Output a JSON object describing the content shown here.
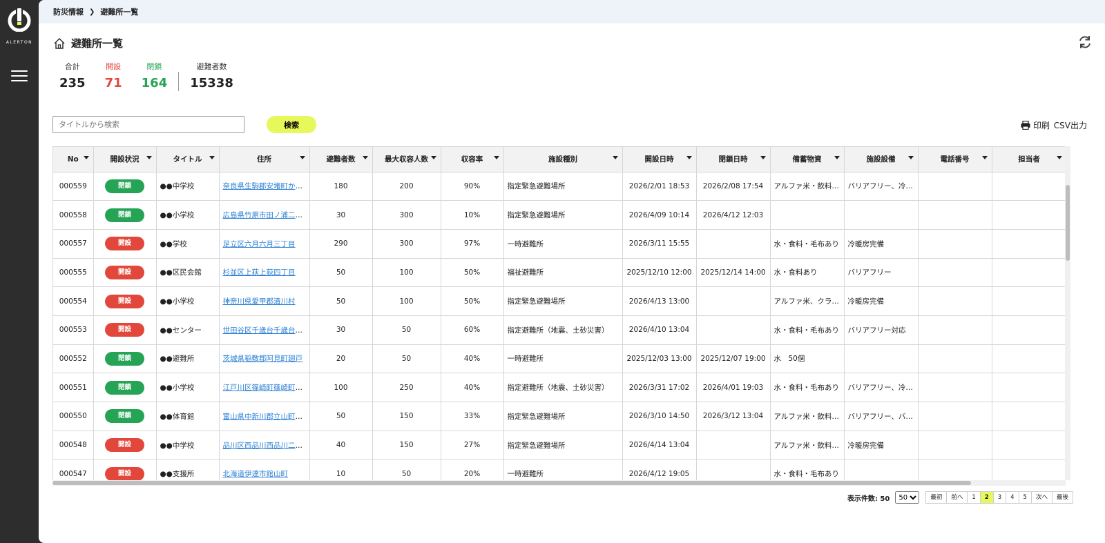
{
  "app": {
    "logo_text": "ALERTON"
  },
  "breadcrumb": {
    "parent": "防災情報",
    "current": "避難所一覧"
  },
  "page": {
    "title": "避難所一覧"
  },
  "stats": {
    "total_label": "合計",
    "total": "235",
    "open_label": "開設",
    "open": "71",
    "closed_label": "閉鎖",
    "closed": "164",
    "evacuees_label": "避難者数",
    "evacuees": "15338"
  },
  "search": {
    "placeholder": "タイトルから検索",
    "button": "検索"
  },
  "actions": {
    "print": "印刷",
    "csv": "CSV出力"
  },
  "colors": {
    "open": "#e2473c",
    "closed": "#26a456",
    "accent": "#e6f85a",
    "link": "#2a7fd4"
  },
  "table": {
    "columns": [
      "No",
      "開設状況",
      "タイトル",
      "住所",
      "避難者数",
      "最大収容人数",
      "収容率",
      "施設種別",
      "開設日時",
      "閉鎖日時",
      "備蓄物資",
      "施設設備",
      "電話番号",
      "担当者"
    ],
    "rows": [
      {
        "no": "000559",
        "status": "閉鎖",
        "state": "closed",
        "title": "●●中学校",
        "address": "奈良県生駒郡安堵町かし…",
        "evacuees": "180",
        "capacity": "200",
        "rate": "90%",
        "type": "指定緊急避難場所",
        "opened": "2026/2/01 18:53",
        "closed_at": "2026/2/08 17:54",
        "stock": "アルファ米・飲料水…",
        "equipment": "バリアフリー、冷暖…",
        "phone": "",
        "staff": ""
      },
      {
        "no": "000558",
        "status": "閉鎖",
        "state": "closed",
        "title": "●●小学校",
        "address": "広島県竹原市田ノ浦二丁目",
        "evacuees": "30",
        "capacity": "300",
        "rate": "10%",
        "type": "指定緊急避難場所",
        "opened": "2026/4/09 10:14",
        "closed_at": "2026/4/12 12:03",
        "stock": "",
        "equipment": "",
        "phone": "",
        "staff": ""
      },
      {
        "no": "000557",
        "status": "開設",
        "state": "open",
        "title": "●●学校",
        "address": "足立区六月六月三丁目",
        "evacuees": "290",
        "capacity": "300",
        "rate": "97%",
        "type": "一時避難所",
        "opened": "2026/3/11 15:55",
        "closed_at": "",
        "stock": "水・食料・毛布あり",
        "equipment": "冷暖房完備",
        "phone": "",
        "staff": ""
      },
      {
        "no": "000555",
        "status": "開設",
        "state": "open",
        "title": "●●区民会館",
        "address": "杉並区上荻上荻四丁目",
        "evacuees": "50",
        "capacity": "100",
        "rate": "50%",
        "type": "福祉避難所",
        "opened": "2025/12/10 12:00",
        "closed_at": "2025/12/14 14:00",
        "stock": "水・食料あり",
        "equipment": "バリアフリー",
        "phone": "",
        "staff": ""
      },
      {
        "no": "000554",
        "status": "開設",
        "state": "open",
        "title": "●●小学校",
        "address": "神奈川県愛甲郡清川村",
        "evacuees": "50",
        "capacity": "100",
        "rate": "50%",
        "type": "指定緊急避難場所",
        "opened": "2026/4/13 13:00",
        "closed_at": "",
        "stock": "アルファ米、クラッ…",
        "equipment": "冷暖房完備",
        "phone": "",
        "staff": ""
      },
      {
        "no": "000553",
        "status": "開設",
        "state": "open",
        "title": "●●センター",
        "address": "世田谷区千歳台千歳台一…",
        "evacuees": "30",
        "capacity": "50",
        "rate": "60%",
        "type": "指定避難所（地震、土砂災害）",
        "opened": "2026/4/10 13:04",
        "closed_at": "",
        "stock": "水・食料・毛布あり",
        "equipment": "バリアフリー対応",
        "phone": "",
        "staff": ""
      },
      {
        "no": "000552",
        "status": "閉鎖",
        "state": "closed",
        "title": "●●避難所",
        "address": "茨城県稲敷郡阿見町廻戸",
        "evacuees": "20",
        "capacity": "50",
        "rate": "40%",
        "type": "一時避難所",
        "opened": "2025/12/03 13:00",
        "closed_at": "2025/12/07 19:00",
        "stock": "水　50個",
        "equipment": "",
        "phone": "",
        "staff": ""
      },
      {
        "no": "000551",
        "status": "閉鎖",
        "state": "closed",
        "title": "●●小学校",
        "address": "江戸川区篠崎町篠崎町三…",
        "evacuees": "100",
        "capacity": "250",
        "rate": "40%",
        "type": "指定避難所（地震、土砂災害）",
        "opened": "2026/3/31 17:02",
        "closed_at": "2026/4/01 19:03",
        "stock": "水・食料・毛布あり",
        "equipment": "バリアフリー、冷暖…",
        "phone": "",
        "staff": ""
      },
      {
        "no": "000550",
        "status": "閉鎖",
        "state": "closed",
        "title": "●●体育館",
        "address": "富山県中新川郡立山町日…",
        "evacuees": "50",
        "capacity": "150",
        "rate": "33%",
        "type": "指定緊急避難場所",
        "opened": "2026/3/10 14:50",
        "closed_at": "2026/3/12 13:04",
        "stock": "アルファ米・飲料水…",
        "equipment": "バリアフリー、バリ…",
        "phone": "",
        "staff": ""
      },
      {
        "no": "000548",
        "status": "開設",
        "state": "open",
        "title": "●●中学校",
        "address": "品川区西品川西品川二丁目",
        "evacuees": "40",
        "capacity": "150",
        "rate": "27%",
        "type": "指定緊急避難場所",
        "opened": "2026/4/14 13:04",
        "closed_at": "",
        "stock": "アルファ米・飲料水…",
        "equipment": "冷暖房完備",
        "phone": "",
        "staff": ""
      },
      {
        "no": "000547",
        "status": "開設",
        "state": "open",
        "title": "●●支援所",
        "address": "北海道伊達市館山町",
        "evacuees": "10",
        "capacity": "50",
        "rate": "20%",
        "type": "一時避難所",
        "opened": "2026/4/12 19:05",
        "closed_at": "",
        "stock": "水・食料・毛布あり",
        "equipment": "",
        "phone": "",
        "staff": ""
      }
    ]
  },
  "pagination": {
    "count_label": "表示件数: 50",
    "page_size": "50",
    "first": "最初",
    "prev": "前へ",
    "pages": [
      "1",
      "2",
      "3",
      "4",
      "5"
    ],
    "current": "2",
    "next": "次へ",
    "last": "最後"
  }
}
